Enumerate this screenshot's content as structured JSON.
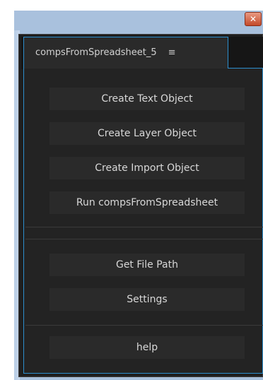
{
  "window": {
    "close_glyph": "✕"
  },
  "panel": {
    "tab_label": "compsFromSpreadsheet_5",
    "tab_menu_glyph": "≡"
  },
  "buttons": {
    "create_text": "Create Text Object",
    "create_layer": "Create Layer Object",
    "create_import": "Create Import Object",
    "run": "Run compsFromSpreadsheet",
    "get_file_path": "Get File Path",
    "settings": "Settings",
    "help": "help"
  },
  "colors": {
    "accent": "#2d8fce",
    "panel_bg": "#232323",
    "button_bg": "#2a2a2a",
    "text": "#d8d8d8"
  }
}
